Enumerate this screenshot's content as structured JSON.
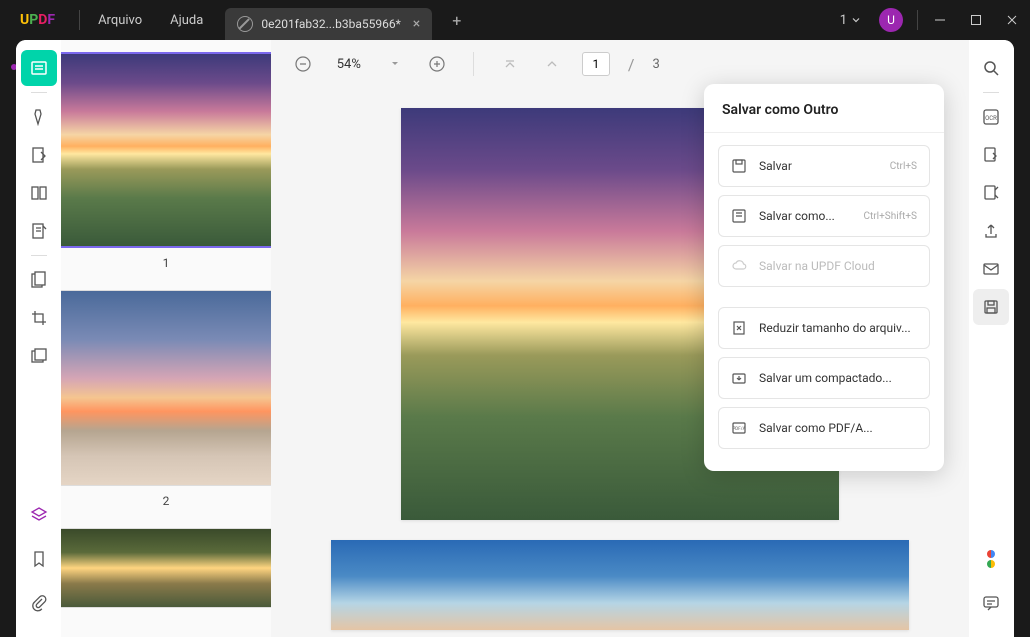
{
  "app": {
    "logo_u": "U",
    "logo_p": "P",
    "logo_d": "D",
    "logo_f": "F"
  },
  "menu": {
    "file": "Arquivo",
    "help": "Ajuda"
  },
  "tab": {
    "label": "0e201fab32...b3ba55966*",
    "count": "1",
    "avatar": "U"
  },
  "toolbar": {
    "zoom": "54%",
    "page_current": "1",
    "page_sep": "/",
    "page_total": "3"
  },
  "thumbs": {
    "p1": "1",
    "p2": "2"
  },
  "dropdown": {
    "title": "Salvar como Outro",
    "save": "Salvar",
    "save_sc": "Ctrl+S",
    "saveas": "Salvar como...",
    "saveas_sc": "Ctrl+Shift+S",
    "cloud": "Salvar na UPDF Cloud",
    "reduce": "Reduzir tamanho do arquiv...",
    "flatten": "Salvar um compactado...",
    "pdfa": "Salvar como PDF/A..."
  }
}
